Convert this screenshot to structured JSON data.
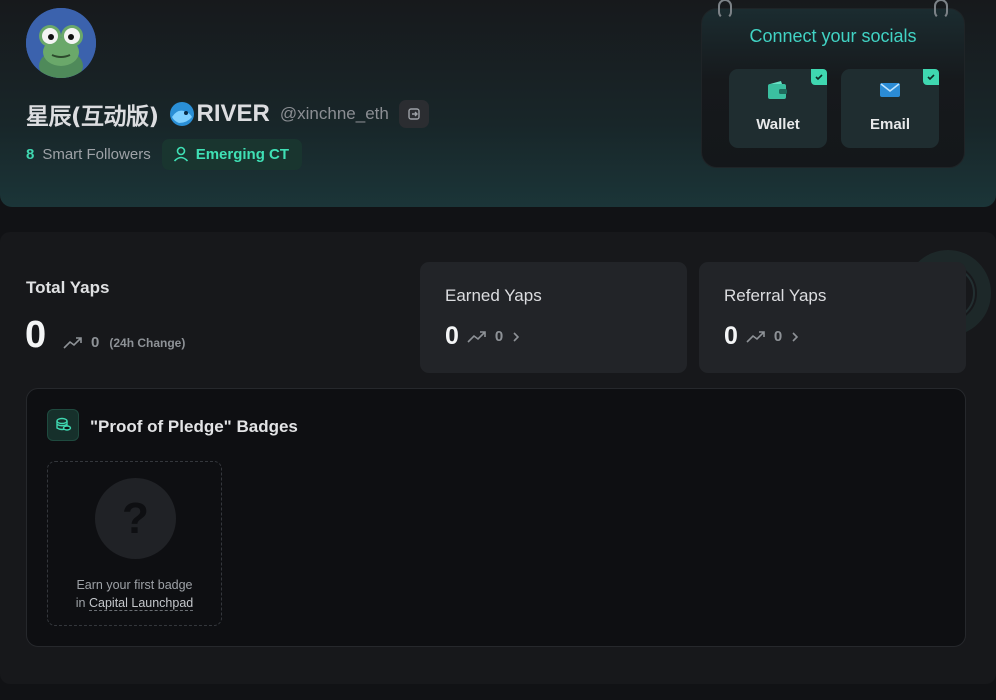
{
  "profile": {
    "display_name": "星辰(互动版)",
    "river_label": "RIVER",
    "handle": "@xinchne_eth",
    "smart_followers_count": "8",
    "smart_followers_label": "Smart Followers",
    "tag": "Emerging CT"
  },
  "socials": {
    "title": "Connect your socials",
    "wallet_label": "Wallet",
    "email_label": "Email"
  },
  "yaps": {
    "total_label": "Total Yaps",
    "total_value": "0",
    "total_change": "0",
    "total_change_note": "(24h Change)",
    "earned_label": "Earned Yaps",
    "earned_value": "0",
    "earned_change": "0",
    "referral_label": "Referral Yaps",
    "referral_value": "0",
    "referral_change": "0"
  },
  "badges": {
    "title": "\"Proof of Pledge\" Badges",
    "placeholder_symbol": "?",
    "hint_prefix": "Earn your first badge",
    "hint_in": "in",
    "hint_link": "Capital Launchpad"
  },
  "colors": {
    "accent": "#3fd7b0",
    "background": "#111215",
    "card": "#222428"
  }
}
